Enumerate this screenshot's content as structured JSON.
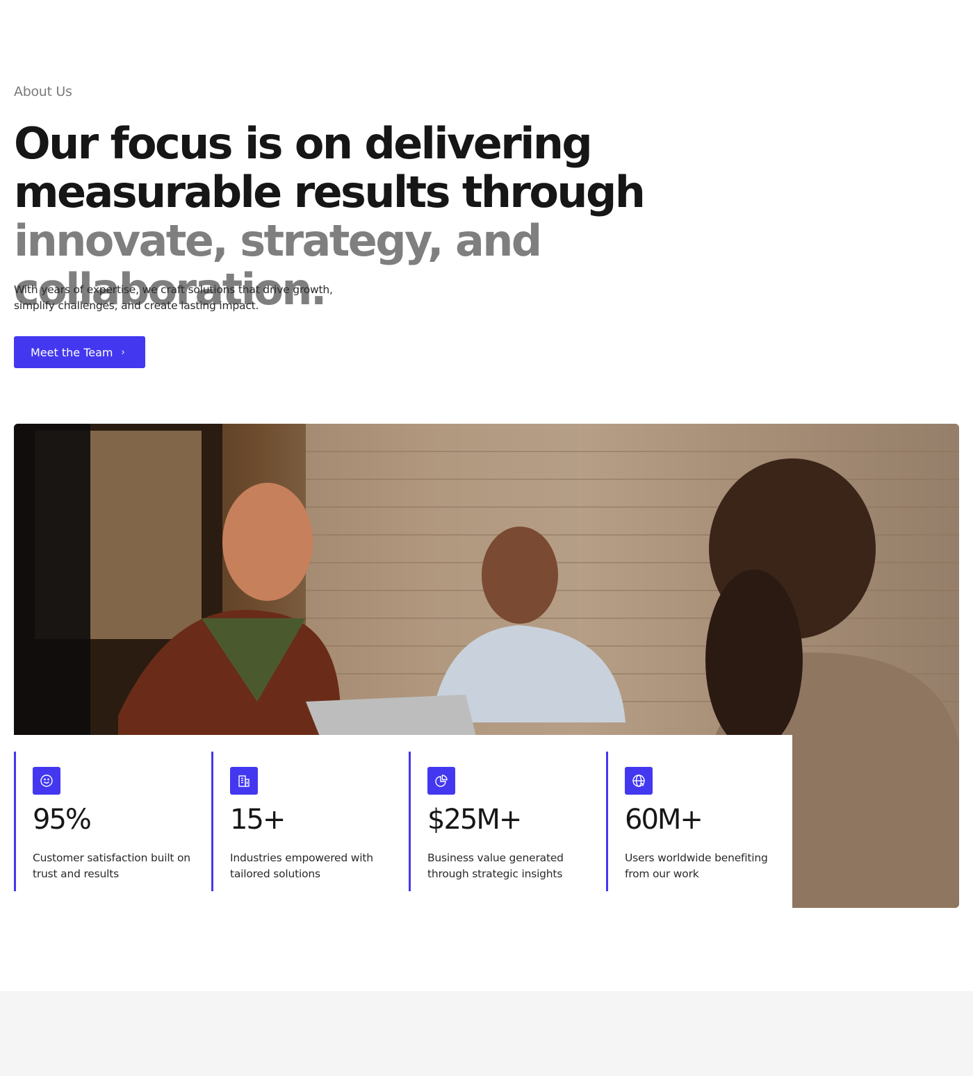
{
  "section_label": "About Us",
  "headline": {
    "dark": "Our focus is on delivering measurable results through",
    "muted": "innovate, strategy, and collaboration."
  },
  "subtext": "With years of expertise, we craft solutions that drive growth, simplify challenges, and create lasting impact.",
  "cta": {
    "label": "Meet the Team",
    "icon": "chevron-right-icon"
  },
  "colors": {
    "accent": "#4338f0",
    "text": "#161616",
    "muted": "#7f7f7f"
  },
  "stats": [
    {
      "icon": "smile-icon",
      "value": "95%",
      "description": "Customer satisfaction built on trust and results"
    },
    {
      "icon": "building-icon",
      "value": "15+",
      "description": "Industries empowered with tailored solutions"
    },
    {
      "icon": "pie-chart-icon",
      "value": "$25M+",
      "description": "Business value generated through strategic insights"
    },
    {
      "icon": "globe-icon",
      "value": "60M+",
      "description": "Users worldwide benefiting from our work"
    }
  ]
}
